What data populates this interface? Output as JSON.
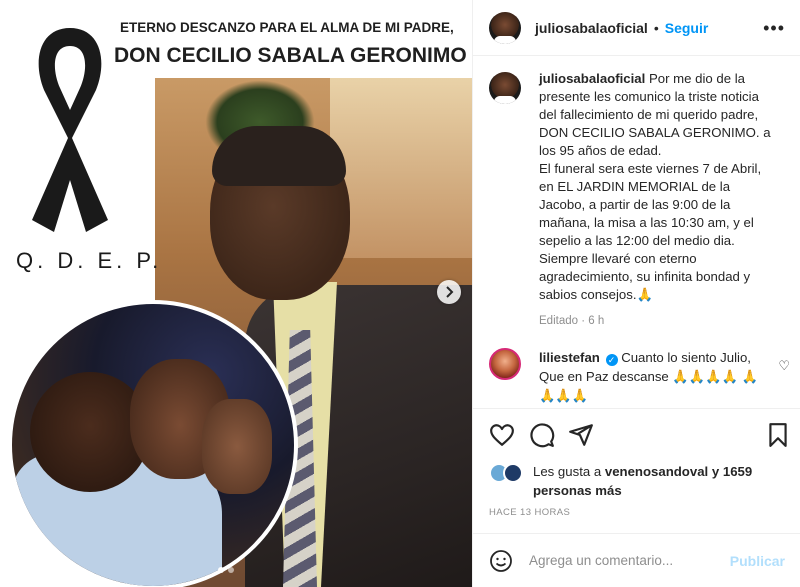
{
  "media": {
    "headline_line1": "ETERNO DESCANZO PARA EL ALMA DE MI PADRE,",
    "headline_line2": "DON CECILIO SABALA GERONIMO",
    "qdep": "Q. D. E. P.",
    "carousel_dots": 2,
    "active_dot": 0,
    "icons": {
      "ribbon": "mourning-ribbon-icon",
      "next": "chevron-right-icon"
    }
  },
  "header": {
    "username": "juliosabalaoficial",
    "separator": "•",
    "follow_label": "Seguir",
    "more_icon": "•••"
  },
  "caption": {
    "username": "juliosabalaoficial",
    "lines": [
      "Por me dio de la",
      "presente les comunico la triste noticia",
      "del fallecimiento de mi querido padre,",
      "DON CECILIO SABALA GERONIMO. a",
      "los 95 años de edad.",
      "El funeral sera este viernes 7 de Abril,",
      "en EL JARDIN MEMORIAL de la",
      "Jacobo, a partir de las 9:00 de la",
      "mañana, la misa a las 10:30 am, y el",
      "sepelio a las 12:00 del medio dia.",
      "Siempre llevaré con eterno",
      "agradecimiento, su infinita bondad y",
      "sabios consejos.🙏"
    ],
    "meta": "Editado · 6 h"
  },
  "comment": {
    "username": "liliestefan",
    "verified_glyph": "✓",
    "text": "Cuanto lo siento Julio, Que en Paz descanse 🙏🙏🙏🙏 🙏🙏🙏🙏",
    "like_icon": "♡"
  },
  "likes": {
    "prefix": "Les gusta a ",
    "user": "venenosandoval",
    "suffix": " y 1659 personas más"
  },
  "timestamp": "HACE 13 HORAS",
  "add_comment": {
    "placeholder": "Agrega un comentario...",
    "post_label": "Publicar"
  },
  "colors": {
    "accent": "#0095f6",
    "post_disabled": "#b2dffc",
    "muted": "#8e8e8e",
    "text": "#262626",
    "border": "#efefef"
  }
}
